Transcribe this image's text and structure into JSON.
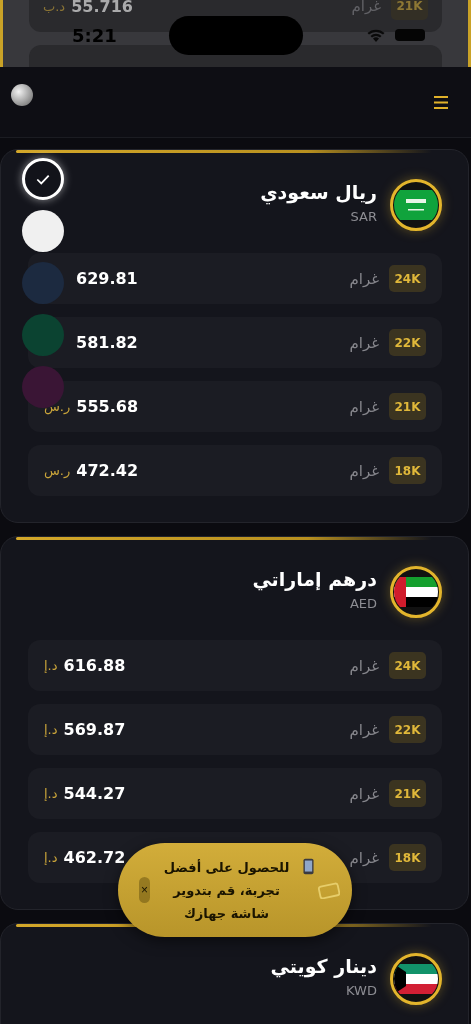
{
  "background_peek": {
    "rows": [
      {
        "value": "55.716",
        "currency": "د.ب",
        "unit": "غرام",
        "karat": "21K"
      }
    ]
  },
  "status_bar": {
    "time": "5:21"
  },
  "cards": [
    {
      "name": "ريال سعودي",
      "code": "SAR",
      "kind": "sa",
      "rows": [
        {
          "karat": "24K",
          "unit": "غرام",
          "value": "629.81"
        },
        {
          "karat": "22K",
          "unit": "غرام",
          "value": "581.82"
        },
        {
          "karat": "21K",
          "unit": "غرام",
          "value": "555.68",
          "currency": "ر.س"
        },
        {
          "karat": "18K",
          "unit": "غرام",
          "value": "472.42",
          "currency": "ر.س"
        }
      ]
    },
    {
      "name": "درهم إماراتي",
      "code": "AED",
      "kind": "ae",
      "rows": [
        {
          "karat": "24K",
          "unit": "غرام",
          "value": "616.88",
          "currency": "د.إ"
        },
        {
          "karat": "22K",
          "unit": "غرام",
          "value": "569.87",
          "currency": "د.إ"
        },
        {
          "karat": "21K",
          "unit": "غرام",
          "value": "544.27",
          "currency": "د.إ"
        },
        {
          "karat": "18K",
          "unit": "غرام",
          "value": "462.72",
          "currency": "د.إ"
        }
      ]
    },
    {
      "name": "دينار كويتي",
      "code": "KWD",
      "kind": "kw"
    }
  ],
  "swatches": [
    {
      "color": "#12131a",
      "selected": true
    },
    {
      "color": "#f0f0f0",
      "selected": false
    },
    {
      "color": "#1c2a40",
      "selected": false
    },
    {
      "color": "#0b4331",
      "selected": false
    },
    {
      "color": "#3a1535",
      "selected": false
    }
  ],
  "toast": {
    "message": "للحصول على أفضل تجربة، قم بتدوير شاشة جهازك",
    "close": "×"
  }
}
